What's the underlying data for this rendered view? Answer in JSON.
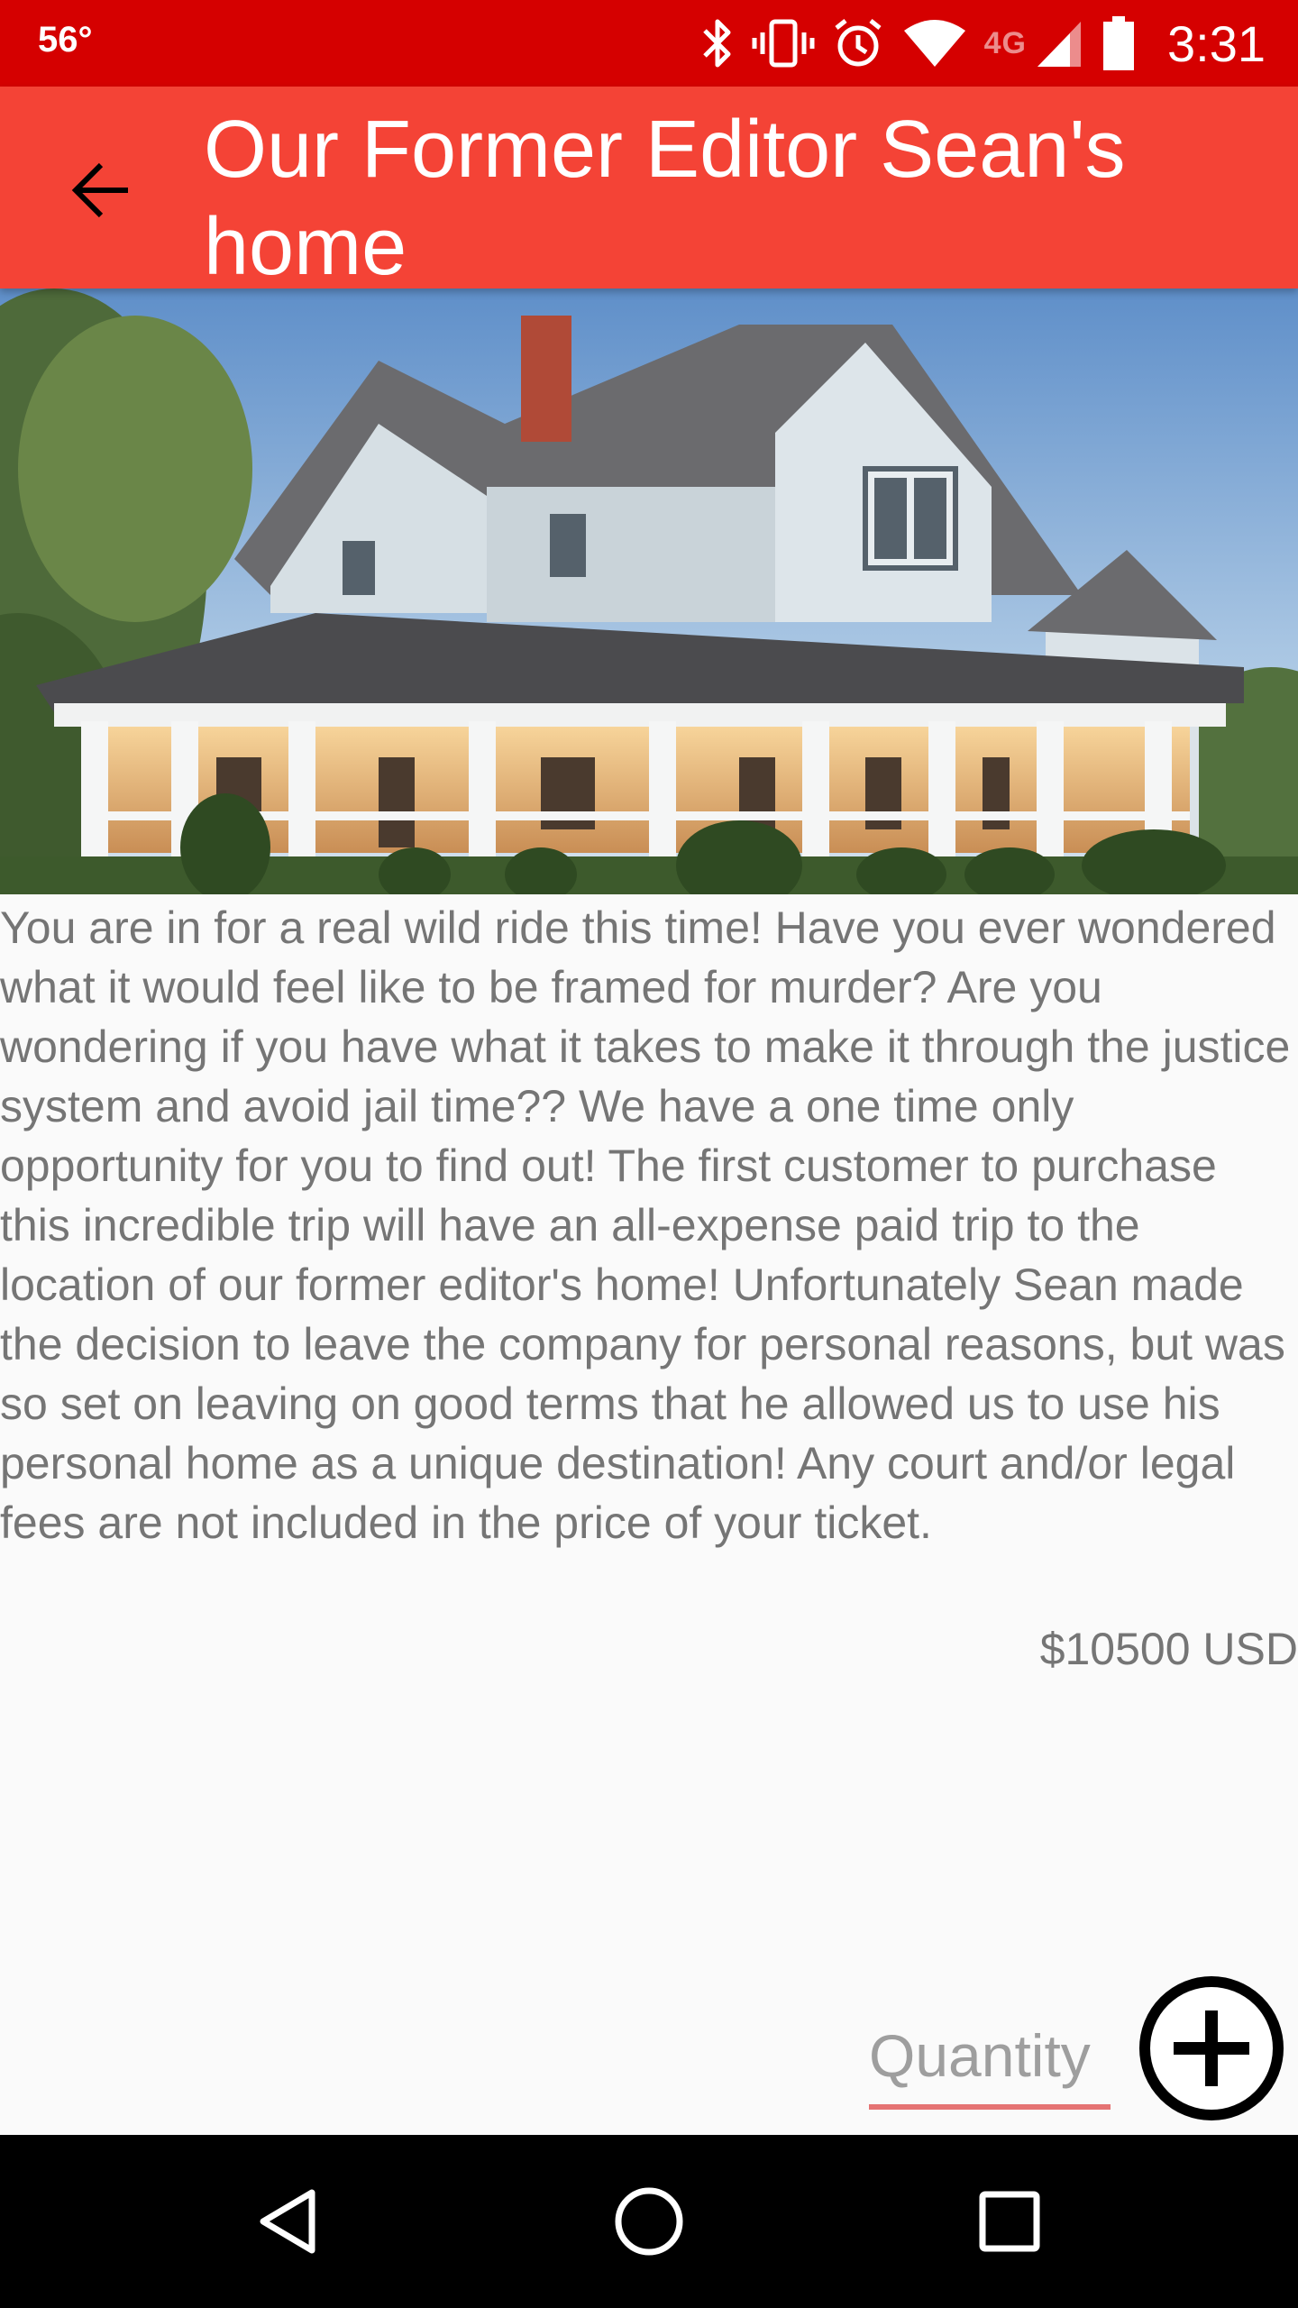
{
  "status_bar": {
    "temperature": "56°",
    "network_label": "4G",
    "time": "3:31",
    "icons": [
      "bluetooth-icon",
      "vibrate-icon",
      "alarm-icon",
      "wifi-icon",
      "cell-signal-icon",
      "battery-icon"
    ]
  },
  "app_bar": {
    "title": "Our Former Editor Sean's home",
    "back_icon": "arrow-back-icon",
    "color": "#f44336"
  },
  "hero_image": {
    "subject": "large white farmhouse with wraparound porch"
  },
  "product": {
    "description": "You are in for a real wild ride this time! Have you ever wondered what it would feel like to be framed for murder? Are you wondering if you have what it takes to make it through the justice system and avoid jail time?? We have a one time only opportunity for you to find out! The first customer to purchase this incredible trip will have an all-expense paid trip to the location of our former editor's home! Unfortunately Sean made the decision to leave the company for personal reasons, but was so set on leaving on good terms that he allowed us to use his personal home as a unique destination! Any court and/or legal fees are not included in the price of your ticket.",
    "price": "$10500 USD"
  },
  "order": {
    "quantity_placeholder": "Quantity",
    "quantity_value": "",
    "add_icon": "add-circle-icon"
  },
  "nav_bar": {
    "back_icon": "nav-back-icon",
    "home_icon": "nav-home-icon",
    "recents_icon": "nav-recents-icon"
  },
  "colors": {
    "status_bar": "#d50000",
    "app_bar": "#f44336",
    "accent_underline": "#e57373",
    "body_text": "#757575"
  }
}
